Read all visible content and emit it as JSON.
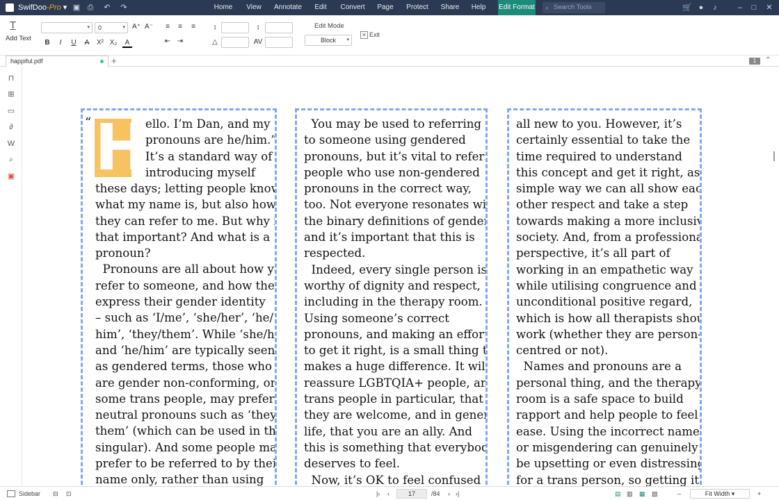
{
  "app": {
    "name": "SwifDoo",
    "edition": "-Pro"
  },
  "menu": [
    "Home",
    "View",
    "Annotate",
    "Edit",
    "Convert",
    "Page",
    "Protect",
    "Share",
    "Help",
    "Edit Format"
  ],
  "search": {
    "placeholder": "Search Tools"
  },
  "toolbar": {
    "add_text_label": "Add Text",
    "font_size_value": "0",
    "edit_mode_label": "Edit Mode",
    "edit_mode_value": "Block",
    "exit_label": "Exit"
  },
  "tab": {
    "filename": "happiful.pdf",
    "add": "+"
  },
  "page_badge": "1",
  "document": {
    "open_quote": "“",
    "dropcap": "H",
    "col1_lines": [
      "ello. I’m Dan, and my",
      "pronouns are he/him.”",
      "It’s a standard way of",
      "introducing myself"
    ],
    "col1_rest": [
      "these days; letting people know",
      "what my name is, but also how",
      "they can refer to me. But why is",
      "that important? And what is a",
      "pronoun?",
      "  Pronouns are all about how you",
      "refer to someone, and how they",
      "express their gender identity",
      "– such as ‘I/me’, ‘she/her’, ‘he/",
      "him’, ‘they/them’. While ‘she/her’",
      "and ‘he/him’ are typically seen",
      "as gendered terms, those who",
      "are gender non-conforming, or",
      "some trans people, may prefer",
      "neutral pronouns such as ‘they/",
      "them’ (which can be used in the",
      "singular). And some people may",
      "prefer to be referred to by their",
      "name only, rather than using"
    ],
    "col2": [
      "  You may be used to referring",
      "to someone using gendered",
      "pronouns, but it’s vital to refer to",
      "people who use non-gendered",
      "pronouns in the correct way,",
      "too. Not everyone resonates with",
      "the binary definitions of gender,",
      "and it’s important that this is",
      "respected.",
      "  Indeed, every single person is",
      "worthy of dignity and respect,",
      "including in the therapy room.",
      "Using someone’s correct",
      "pronouns, and making an effort",
      "to get it right, is a small thing that",
      "makes a huge difference. It will",
      "reassure LGBTQIA+ people, and",
      "trans people in particular, that",
      "they are welcome, and in general",
      "life, that you are an ally. And",
      "this is something that everybody",
      "deserves to feel.",
      "  Now, it’s OK to feel confused"
    ],
    "col3": [
      "all new to you. However, it’s",
      "certainly essential to take the",
      "time required to understand",
      "this concept and get it right, as a",
      "simple way we can all show each",
      "other respect and take a step",
      "towards making a more inclusive",
      "society. And, from a professional",
      "perspective, it’s all part of",
      "working in an empathetic way",
      "while utilising congruence and",
      "unconditional positive regard,",
      "which is how all therapists should",
      "work (whether they are person-",
      "centred or not).",
      "  Names and pronouns are a",
      "personal thing, and the therapy",
      "room is a safe space to build",
      "rapport and help people to feel at",
      "ease. Using the incorrect name",
      "or misgendering can genuinely",
      "be upsetting or even distressing",
      "for a trans person, so getting it"
    ]
  },
  "status": {
    "sidebar_label": "Sidebar",
    "current_page": "17",
    "total_pages": "/84",
    "zoom_mode": "Fit Width"
  },
  "colors": {
    "titlebar": "#2b3a52",
    "active_menu": "#1e8a7a",
    "dropcap": "#f7c260",
    "block_border": "#7fa8f0"
  }
}
